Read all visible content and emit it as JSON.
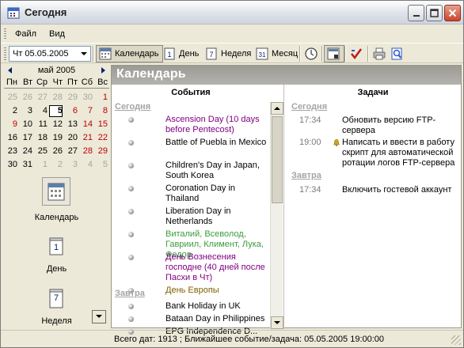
{
  "window": {
    "title": "Сегодня",
    "controls": [
      "minimize",
      "maximize",
      "close"
    ]
  },
  "menu": [
    "Файл",
    "Вид"
  ],
  "toolbar": {
    "date_value": "Чт 05.05.2005",
    "buttons": {
      "calendar": "Календарь",
      "day": "День",
      "week": "Неделя",
      "month": "Месяц"
    },
    "icons": [
      "calendar-icon",
      "day-icon",
      "week-icon",
      "month-icon",
      "clock-icon",
      "grid-icon",
      "checkmark-icon",
      "printer-icon",
      "search-icon"
    ]
  },
  "mini_calendar": {
    "month_label": "май 2005",
    "weekdays": [
      "Пн",
      "Вт",
      "Ср",
      "Чт",
      "Пт",
      "Сб",
      "Вс"
    ],
    "weeks": [
      [
        {
          "d": "25",
          "m": 1
        },
        {
          "d": "26",
          "m": 1
        },
        {
          "d": "27",
          "m": 1
        },
        {
          "d": "28",
          "m": 1
        },
        {
          "d": "29",
          "m": 1
        },
        {
          "d": "30",
          "m": 1
        },
        {
          "d": "1",
          "r": 1
        }
      ],
      [
        {
          "d": "2"
        },
        {
          "d": "3"
        },
        {
          "d": "4"
        },
        {
          "d": "5",
          "t": 1
        },
        {
          "d": "6",
          "r": 1
        },
        {
          "d": "7",
          "r": 1
        },
        {
          "d": "8",
          "r": 1
        }
      ],
      [
        {
          "d": "9",
          "r": 1
        },
        {
          "d": "10"
        },
        {
          "d": "11"
        },
        {
          "d": "12"
        },
        {
          "d": "13"
        },
        {
          "d": "14",
          "r": 1
        },
        {
          "d": "15",
          "r": 1
        }
      ],
      [
        {
          "d": "16"
        },
        {
          "d": "17"
        },
        {
          "d": "18"
        },
        {
          "d": "19"
        },
        {
          "d": "20"
        },
        {
          "d": "21",
          "r": 1
        },
        {
          "d": "22",
          "r": 1
        }
      ],
      [
        {
          "d": "23"
        },
        {
          "d": "24"
        },
        {
          "d": "25"
        },
        {
          "d": "26"
        },
        {
          "d": "27"
        },
        {
          "d": "28",
          "r": 1
        },
        {
          "d": "29",
          "r": 1
        }
      ],
      [
        {
          "d": "30"
        },
        {
          "d": "31"
        },
        {
          "d": "1",
          "m": 1
        },
        {
          "d": "2",
          "m": 1
        },
        {
          "d": "3",
          "m": 1
        },
        {
          "d": "4",
          "m": 1
        },
        {
          "d": "5",
          "m": 1
        }
      ]
    ]
  },
  "nav": {
    "calendar": "Календарь",
    "day": "День",
    "day_icon_number": "1",
    "week": "Неделя",
    "week_icon_number": "7"
  },
  "main": {
    "header": "Календарь",
    "events_header": "События",
    "tasks_header": "Задачи",
    "today_label": "Сегодня",
    "tomorrow_label": "Завтра",
    "colors": {
      "purple": "#800080",
      "green": "#3a9c3a",
      "olive": "#806000",
      "gray": "#7b7b7b"
    },
    "events_today": [
      {
        "text": "Ascension Day (10 days before Pentecost)",
        "color": "purple"
      },
      {
        "text": "Battle of Puebla in Mexico",
        "color": "black"
      },
      {
        "text": "Children's Day in Japan, South Korea",
        "color": "black"
      },
      {
        "text": "Coronation Day in Thailand",
        "color": "black"
      },
      {
        "text": "Liberation Day in Netherlands",
        "color": "black"
      },
      {
        "text": "Виталий, Всеволод, Гавриил, Климент, Лука, Федор",
        "color": "green"
      },
      {
        "text": "День Вознесения господне (40 дней после Пасхи в Чт)",
        "color": "purple"
      },
      {
        "text": "День Европы",
        "color": "olive"
      }
    ],
    "events_tomorrow": [
      {
        "text": "Bank Holiday in UK",
        "color": "black"
      },
      {
        "text": "Bataan Day in Philippines",
        "color": "black"
      },
      {
        "text": "EPG Independence D...",
        "color": "black"
      }
    ],
    "tasks_today": [
      {
        "time": "17:34",
        "text": "Обновить версию FTP-сервера",
        "bell": false
      },
      {
        "time": "19:00",
        "text": "Написать и ввести в работу скрипт для автоматической ротации логов FTP-сервера",
        "bell": true
      }
    ],
    "tasks_tomorrow": [
      {
        "time": "17:34",
        "text": "Включить гостевой аккаунт",
        "bell": false
      }
    ]
  },
  "status": "Всего дат: 1913 ; Ближайшее событие/задача: 05.05.2005 19:00:00"
}
